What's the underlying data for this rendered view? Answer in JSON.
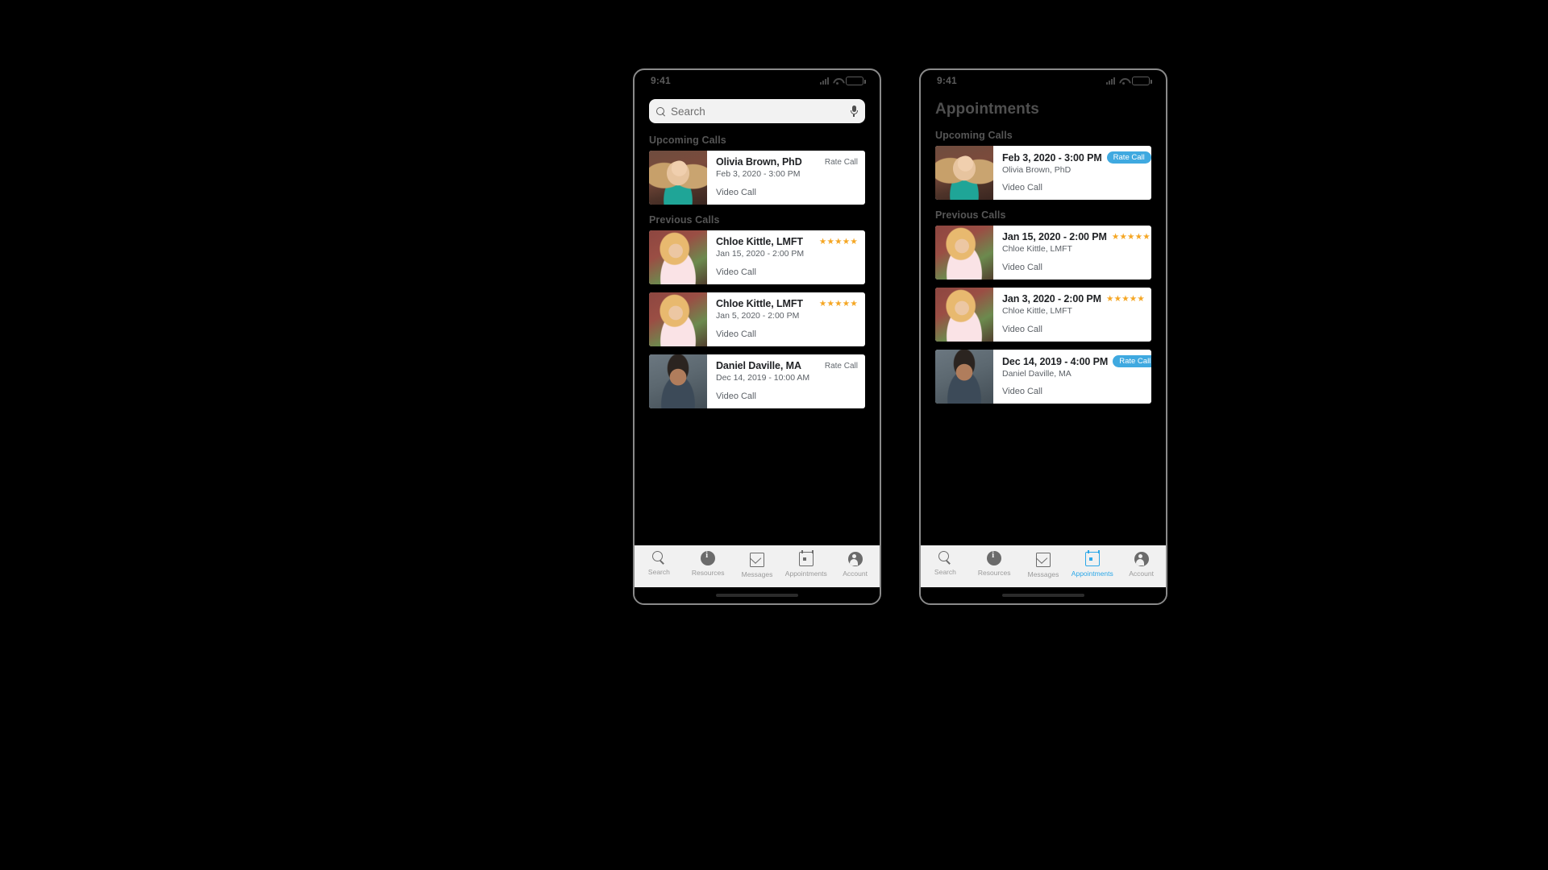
{
  "theme": {
    "accent": "#2ba7e8",
    "badge_bg": "#3fa9e0",
    "star_color": "#f5a623",
    "card_bg": "#ffffff",
    "tabbar_bg": "#f1f1f1",
    "backdrop": "#000000"
  },
  "phone_left": {
    "status": {
      "time": "9:41",
      "signal_icon": "cellular-signal-icon",
      "wifi_icon": "wifi-icon",
      "battery_icon": "battery-icon"
    },
    "search": {
      "placeholder": "Search",
      "value": "",
      "search_icon": "search-icon",
      "mic_icon": "microphone-icon"
    },
    "sections": [
      {
        "title": "Upcoming Calls",
        "cards": [
          {
            "primary": "Olivia Brown, PhD",
            "secondary": "Feb 3, 2020 - 3:00 PM",
            "call_type": "Video Call",
            "action_label": "Rate Call",
            "action_kind": "link",
            "avatar": "olivia-brown-avatar",
            "rating": null
          }
        ]
      },
      {
        "title": "Previous Calls",
        "cards": [
          {
            "primary": "Chloe Kittle, LMFT",
            "secondary": "Jan 15, 2020 - 2:00 PM",
            "call_type": "Video Call",
            "action_label": "",
            "action_kind": "stars",
            "avatar": "chloe-kittle-avatar",
            "rating": "★★★★★"
          },
          {
            "primary": "Chloe Kittle, LMFT",
            "secondary": "Jan 5, 2020 - 2:00 PM",
            "call_type": "Video Call",
            "action_label": "",
            "action_kind": "stars",
            "avatar": "chloe-kittle-avatar",
            "rating": "★★★★★"
          },
          {
            "primary": "Daniel Daville, MA",
            "secondary": "Dec 14, 2019 - 10:00 AM",
            "call_type": "Video Call",
            "action_label": "Rate Call",
            "action_kind": "link",
            "avatar": "daniel-daville-avatar",
            "rating": null
          }
        ]
      }
    ],
    "tabs": [
      {
        "label": "Search",
        "icon": "search-icon",
        "active": false
      },
      {
        "label": "Resources",
        "icon": "info-icon",
        "active": false
      },
      {
        "label": "Messages",
        "icon": "mail-icon",
        "active": false
      },
      {
        "label": "Appointments",
        "icon": "calendar-icon",
        "active": false
      },
      {
        "label": "Account",
        "icon": "person-icon",
        "active": false
      }
    ]
  },
  "phone_right": {
    "status": {
      "time": "9:41",
      "signal_icon": "cellular-signal-icon",
      "wifi_icon": "wifi-icon",
      "battery_icon": "battery-icon"
    },
    "page_title": "Appointments",
    "sections": [
      {
        "title": "Upcoming Calls",
        "cards": [
          {
            "primary": "Feb 3, 2020 - 3:00 PM",
            "secondary": "Olivia Brown, PhD",
            "call_type": "Video Call",
            "action_label": "Rate Call",
            "action_kind": "badge",
            "avatar": "olivia-brown-avatar",
            "rating": null
          }
        ]
      },
      {
        "title": "Previous Calls",
        "cards": [
          {
            "primary": "Jan 15, 2020 - 2:00 PM",
            "secondary": "Chloe Kittle, LMFT",
            "call_type": "Video Call",
            "action_label": "",
            "action_kind": "stars",
            "avatar": "chloe-kittle-avatar",
            "rating": "★★★★★"
          },
          {
            "primary": "Jan 3, 2020 - 2:00 PM",
            "secondary": "Chloe Kittle, LMFT",
            "call_type": "Video Call",
            "action_label": "",
            "action_kind": "stars",
            "avatar": "chloe-kittle-avatar",
            "rating": "★★★★★"
          },
          {
            "primary": "Dec 14, 2019 - 4:00 PM",
            "secondary": "Daniel Daville, MA",
            "call_type": "Video Call",
            "action_label": "Rate Call",
            "action_kind": "badge",
            "avatar": "daniel-daville-avatar",
            "rating": null
          }
        ]
      }
    ],
    "tabs": [
      {
        "label": "Search",
        "icon": "search-icon",
        "active": false
      },
      {
        "label": "Resources",
        "icon": "info-icon",
        "active": false
      },
      {
        "label": "Messages",
        "icon": "mail-icon",
        "active": false
      },
      {
        "label": "Appointments",
        "icon": "calendar-icon",
        "active": true
      },
      {
        "label": "Account",
        "icon": "person-icon",
        "active": false
      }
    ]
  }
}
